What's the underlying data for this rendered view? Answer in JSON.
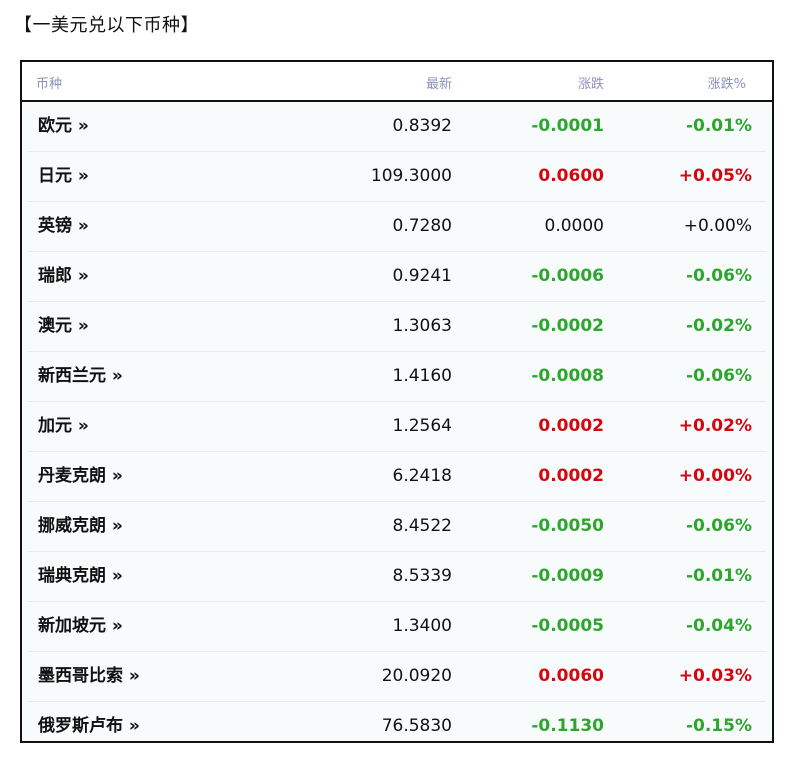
{
  "page": {
    "title": "【一美元兑以下币种】"
  },
  "table": {
    "headers": {
      "name": "币种",
      "latest": "最新",
      "change": "涨跌",
      "pct": "涨跌%"
    },
    "rows": [
      {
        "name": "欧元 »",
        "latest": "0.8392",
        "change": "-0.0001",
        "pct": "-0.01%",
        "trend": "down"
      },
      {
        "name": "日元 »",
        "latest": "109.3000",
        "change": "0.0600",
        "pct": "+0.05%",
        "trend": "up"
      },
      {
        "name": "英镑 »",
        "latest": "0.7280",
        "change": "0.0000",
        "pct": "+0.00%",
        "trend": "flat"
      },
      {
        "name": "瑞郎 »",
        "latest": "0.9241",
        "change": "-0.0006",
        "pct": "-0.06%",
        "trend": "down"
      },
      {
        "name": "澳元 »",
        "latest": "1.3063",
        "change": "-0.0002",
        "pct": "-0.02%",
        "trend": "down"
      },
      {
        "name": "新西兰元 »",
        "latest": "1.4160",
        "change": "-0.0008",
        "pct": "-0.06%",
        "trend": "down"
      },
      {
        "name": "加元 »",
        "latest": "1.2564",
        "change": "0.0002",
        "pct": "+0.02%",
        "trend": "up"
      },
      {
        "name": "丹麦克朗 »",
        "latest": "6.2418",
        "change": "0.0002",
        "pct": "+0.00%",
        "trend": "up"
      },
      {
        "name": "挪威克朗 »",
        "latest": "8.4522",
        "change": "-0.0050",
        "pct": "-0.06%",
        "trend": "down"
      },
      {
        "name": "瑞典克朗 »",
        "latest": "8.5339",
        "change": "-0.0009",
        "pct": "-0.01%",
        "trend": "down"
      },
      {
        "name": "新加坡元 »",
        "latest": "1.3400",
        "change": "-0.0005",
        "pct": "-0.04%",
        "trend": "down"
      },
      {
        "name": "墨西哥比索 »",
        "latest": "20.0920",
        "change": "0.0060",
        "pct": "+0.03%",
        "trend": "up"
      },
      {
        "name": "俄罗斯卢布 »",
        "latest": "76.5830",
        "change": "-0.1130",
        "pct": "-0.15%",
        "trend": "down"
      }
    ]
  },
  "colors": {
    "up": "#d4070f",
    "down": "#2ea52e",
    "header_text": "#8a92ba"
  }
}
